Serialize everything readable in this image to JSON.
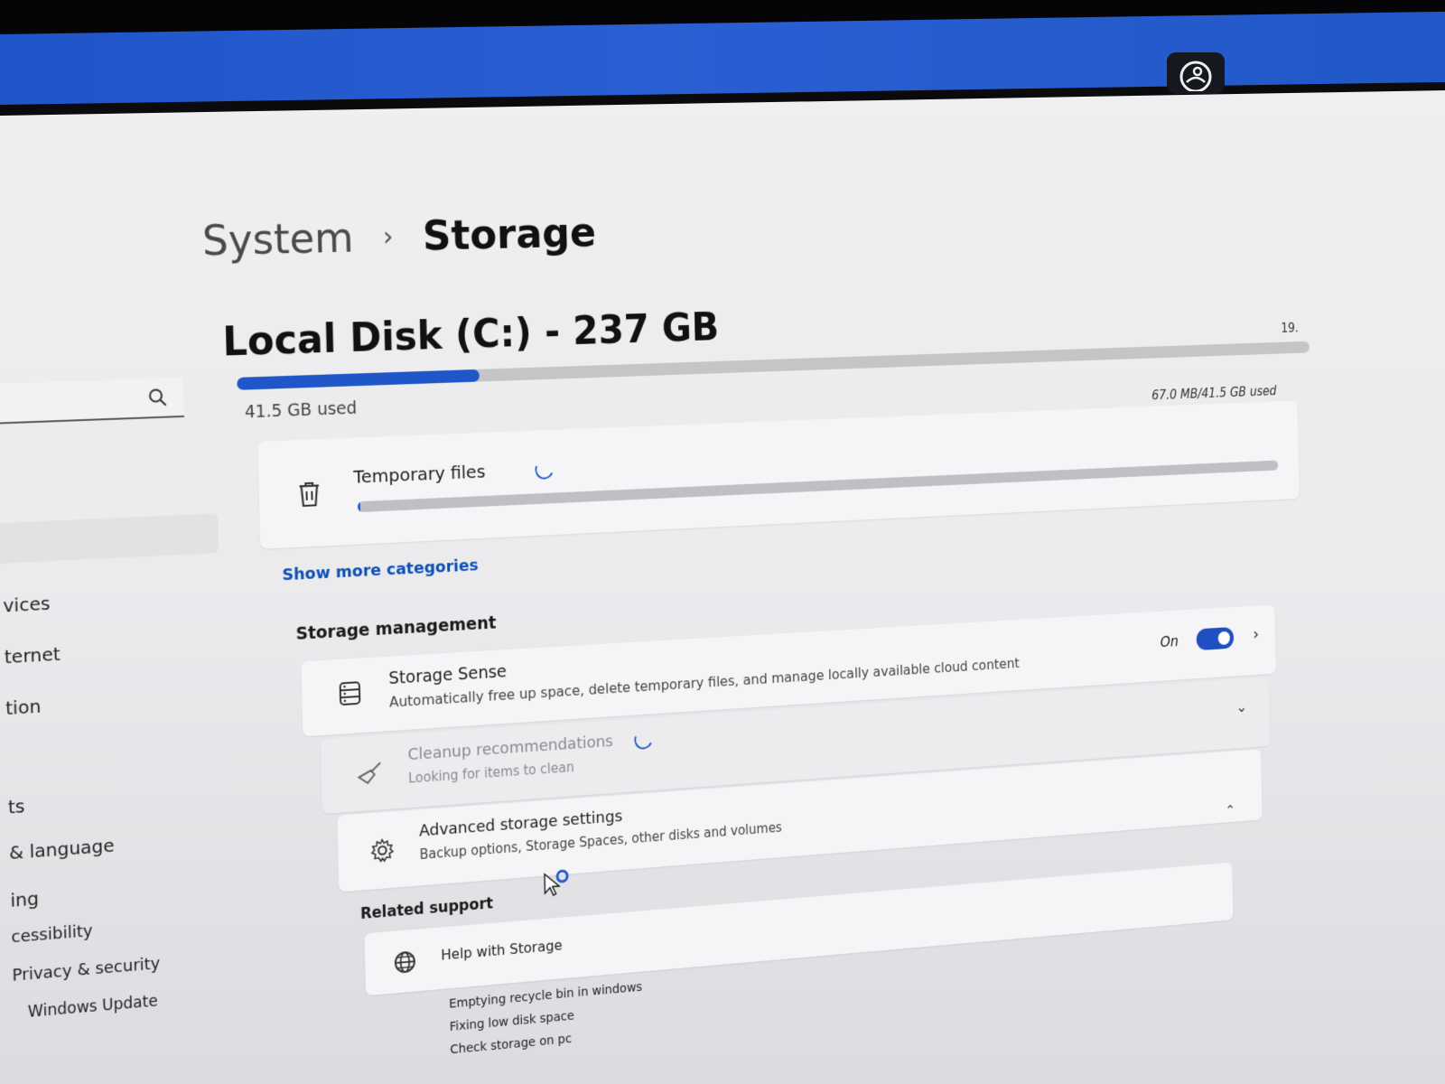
{
  "breadcrumb": {
    "parent": "System",
    "separator": "›",
    "current": "Storage"
  },
  "disk": {
    "title": "Local Disk (C:) - 237 GB",
    "used_label": "41.5 GB used",
    "used_fraction": 0.21,
    "right_label": "19."
  },
  "sidebar": {
    "items": [
      {
        "label": "vices"
      },
      {
        "label": "ternet"
      },
      {
        "label": "tion"
      },
      {
        "label": "ts"
      },
      {
        "label": "& language"
      },
      {
        "label": "ing"
      },
      {
        "label": "cessibility"
      },
      {
        "label": "Privacy & security"
      },
      {
        "label": "Windows Update"
      }
    ]
  },
  "temporary_files": {
    "label": "Temporary files",
    "size_label": "67.0 MB/41.5 GB used",
    "fraction": 0.002
  },
  "show_more": "Show more categories",
  "storage_management": {
    "title": "Storage management",
    "storage_sense": {
      "title": "Storage Sense",
      "description": "Automatically free up space, delete temporary files, and manage locally available cloud content",
      "toggle_label": "On",
      "toggle_on": true
    },
    "cleanup": {
      "title": "Cleanup recommendations",
      "description": "Looking for items to clean"
    },
    "advanced": {
      "title": "Advanced storage settings",
      "description": "Backup options, Storage Spaces, other disks and volumes"
    }
  },
  "related_support": {
    "title": "Related support",
    "help_label": "Help with Storage",
    "links": [
      "Emptying recycle bin in windows",
      "Fixing low disk space",
      "Check storage on pc"
    ]
  },
  "colors": {
    "accent": "#1f57c8",
    "title_bar": "#2158c8"
  }
}
